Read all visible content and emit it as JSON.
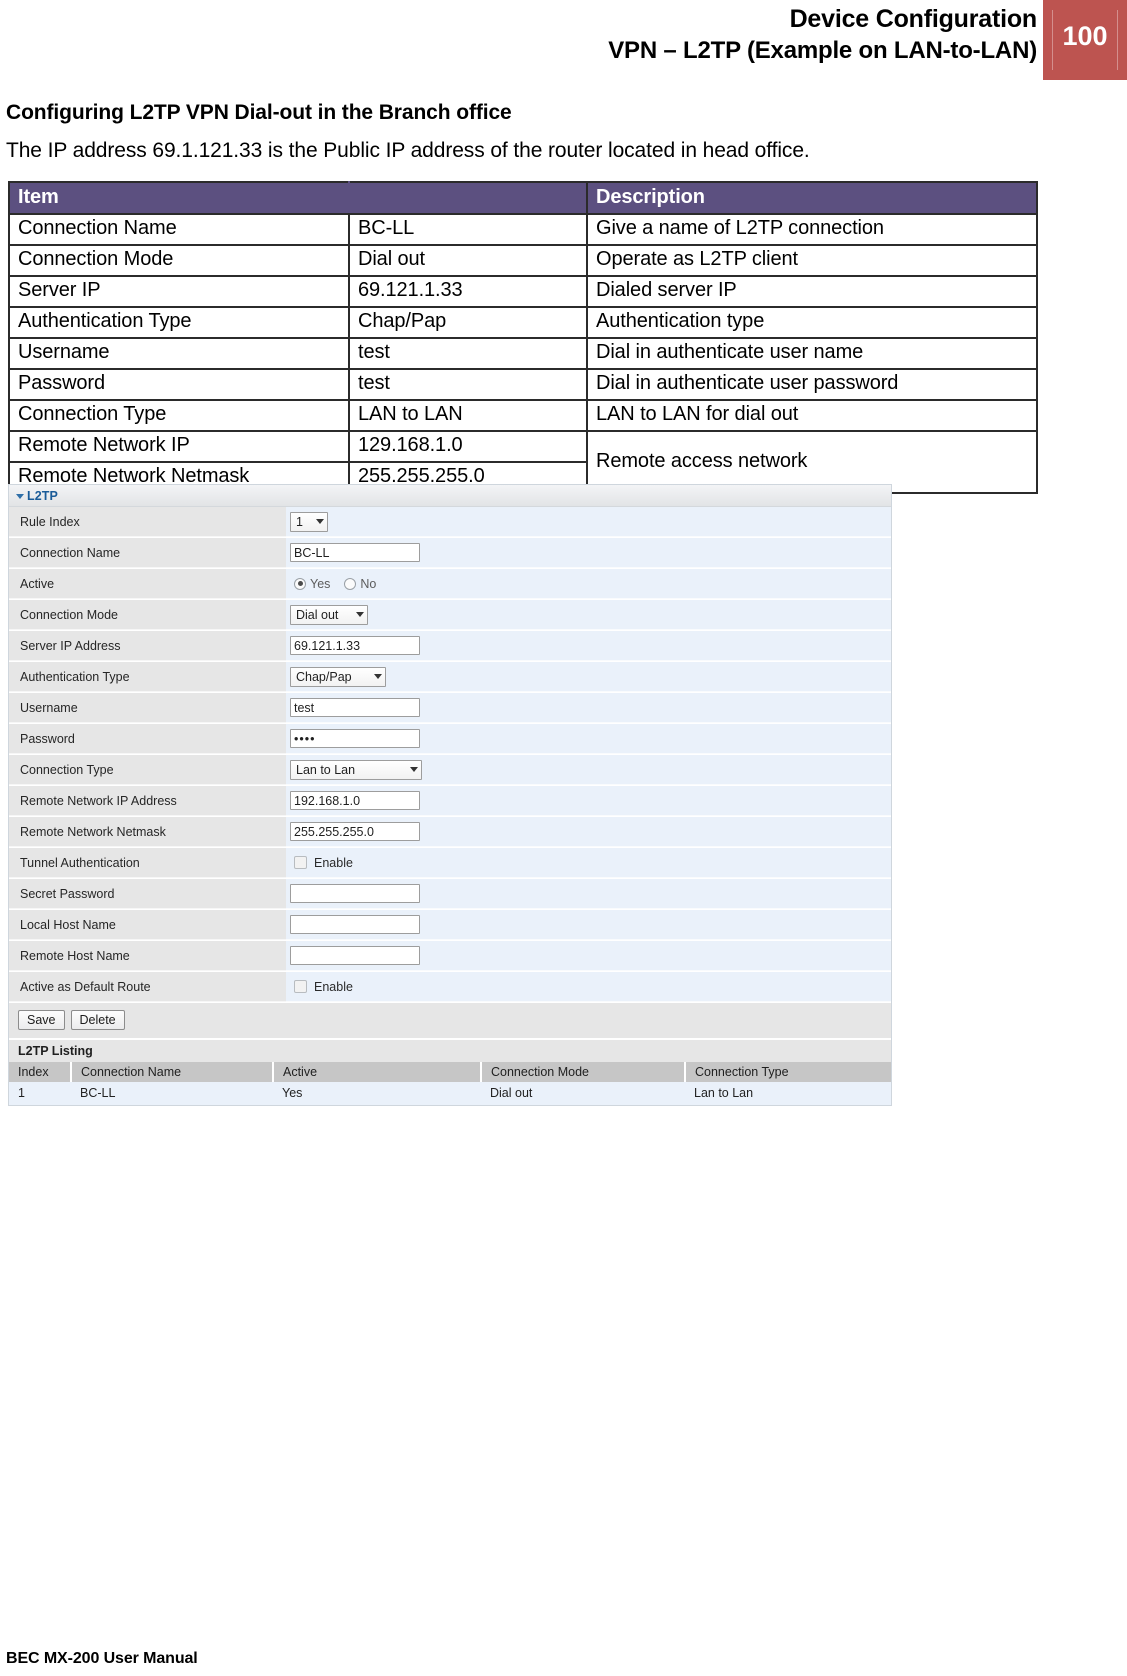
{
  "header": {
    "title_line1": "Device Configuration",
    "title_line2": "VPN – L2TP (Example on LAN-to-LAN)",
    "page_number": "100",
    "badge_color": "#bd5450"
  },
  "body": {
    "section_heading": "Configuring L2TP VPN Dial-out in the Branch office",
    "intro_text": "The IP address 69.1.121.33 is the Public IP address of the router located in head office."
  },
  "spec_table": {
    "header_color": "#5c5080",
    "columns": [
      "Item",
      "Description"
    ],
    "rows": [
      {
        "item": "Connection Name",
        "value": "BC-LL",
        "description": "Give a name of L2TP connection"
      },
      {
        "item": "Connection Mode",
        "value": "Dial out",
        "description": "Operate as L2TP client"
      },
      {
        "item": "Server IP",
        "value": "69.121.1.33",
        "description": "Dialed server IP"
      },
      {
        "item": "Authentication Type",
        "value": "Chap/Pap",
        "description": "Authentication type"
      },
      {
        "item": "Username",
        "value": "test",
        "description": "Dial in authenticate user name"
      },
      {
        "item": "Password",
        "value": "test",
        "description": "Dial in authenticate user password"
      },
      {
        "item": "Connection Type",
        "value": "LAN to LAN",
        "description": "LAN to LAN for dial out"
      },
      {
        "item": "Remote Network IP",
        "value": "129.168.1.0",
        "description": "Remote access network"
      },
      {
        "item": "Remote Network Netmask",
        "value": "255.255.255.0",
        "description": ""
      }
    ]
  },
  "ui": {
    "panel_title": "L2TP",
    "fields": {
      "rule_index": {
        "label": "Rule Index",
        "value": "1"
      },
      "connection_name": {
        "label": "Connection Name",
        "value": "BC-LL"
      },
      "active": {
        "label": "Active",
        "yes": "Yes",
        "no": "No",
        "selected": "Yes"
      },
      "connection_mode": {
        "label": "Connection Mode",
        "value": "Dial out"
      },
      "server_ip": {
        "label": "Server IP Address",
        "value": "69.121.1.33"
      },
      "auth_type": {
        "label": "Authentication Type",
        "value": "Chap/Pap"
      },
      "username": {
        "label": "Username",
        "value": "test"
      },
      "password": {
        "label": "Password",
        "value": "••••"
      },
      "connection_type": {
        "label": "Connection Type",
        "value": "Lan to Lan"
      },
      "remote_ip": {
        "label": "Remote Network IP Address",
        "value": "192.168.1.0"
      },
      "remote_netmask": {
        "label": "Remote Network Netmask",
        "value": "255.255.255.0"
      },
      "tunnel_auth": {
        "label": "Tunnel Authentication",
        "enable_label": "Enable",
        "checked": false
      },
      "secret_password": {
        "label": "Secret Password",
        "value": ""
      },
      "local_host": {
        "label": "Local Host Name",
        "value": ""
      },
      "remote_host": {
        "label": "Remote Host Name",
        "value": ""
      },
      "default_route": {
        "label": "Active as Default Route",
        "enable_label": "Enable",
        "checked": false
      }
    },
    "buttons": {
      "save": "Save",
      "delete": "Delete"
    },
    "listing": {
      "title": "L2TP Listing",
      "columns": [
        "Index",
        "Connection Name",
        "Active",
        "Connection Mode",
        "Connection Type"
      ],
      "rows": [
        {
          "index": "1",
          "name": "BC-LL",
          "active": "Yes",
          "mode": "Dial out",
          "type": "Lan to Lan"
        }
      ]
    }
  },
  "footer": {
    "text": "BEC MX-200 User Manual"
  }
}
